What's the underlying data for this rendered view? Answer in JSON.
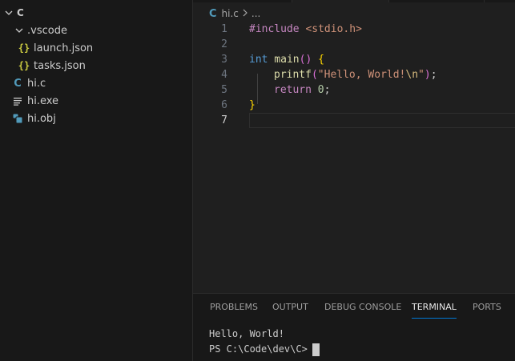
{
  "explorer": {
    "root": {
      "label": "C",
      "icon": "chevron-down-icon"
    },
    "items": [
      {
        "label": ".vscode",
        "kind": "folder",
        "icon": "chevron-down-icon"
      },
      {
        "label": "launch.json",
        "kind": "json",
        "icon": "json-braces-icon",
        "glyph": "{}"
      },
      {
        "label": "tasks.json",
        "kind": "json",
        "icon": "json-braces-icon",
        "glyph": "{}"
      },
      {
        "label": "hi.c",
        "kind": "c",
        "icon": "c-file-icon",
        "glyph": "C"
      },
      {
        "label": "hi.exe",
        "kind": "exe",
        "icon": "exe-file-icon"
      },
      {
        "label": "hi.obj",
        "kind": "obj",
        "icon": "obj-file-icon"
      }
    ]
  },
  "breadcrumb": {
    "icon_glyph": "C",
    "file": "hi.c",
    "separator": ">",
    "rest": "..."
  },
  "editor": {
    "line_numbers": [
      "1",
      "2",
      "3",
      "4",
      "5",
      "6",
      "7"
    ],
    "active_line": "7",
    "lines": {
      "l1": {
        "pre": "#include",
        "space": " ",
        "header": "<stdio.h>"
      },
      "l3": {
        "kw": "int",
        "sp": " ",
        "fn": "main",
        "op": "(",
        "cp": ")",
        "sp2": " ",
        "ob": "{"
      },
      "l4": {
        "fn": "printf",
        "op": "(",
        "str1": "\"Hello, World!",
        "esc": "\\n",
        "str2": "\"",
        "cp": ")",
        "semi": ";"
      },
      "l5": {
        "kw": "return",
        "sp": " ",
        "num": "0",
        "semi": ";"
      },
      "l6": {
        "cb": "}"
      }
    },
    "colors": {
      "preprocessor": "#c586c0",
      "string": "#ce9178",
      "keyword": "#569cd6",
      "function": "#dcdcaa",
      "bracket_level1": "#ffd700",
      "bracket_level2": "#da70d6",
      "escape": "#d7ba7d",
      "number": "#b5cea8"
    }
  },
  "panel": {
    "tabs": [
      "PROBLEMS",
      "OUTPUT",
      "DEBUG CONSOLE",
      "TERMINAL",
      "PORTS"
    ],
    "active_tab": "TERMINAL",
    "accent": "#0078d4",
    "terminal": {
      "output": "Hello, World!",
      "prompt": "PS C:\\Code\\dev\\C>"
    }
  }
}
